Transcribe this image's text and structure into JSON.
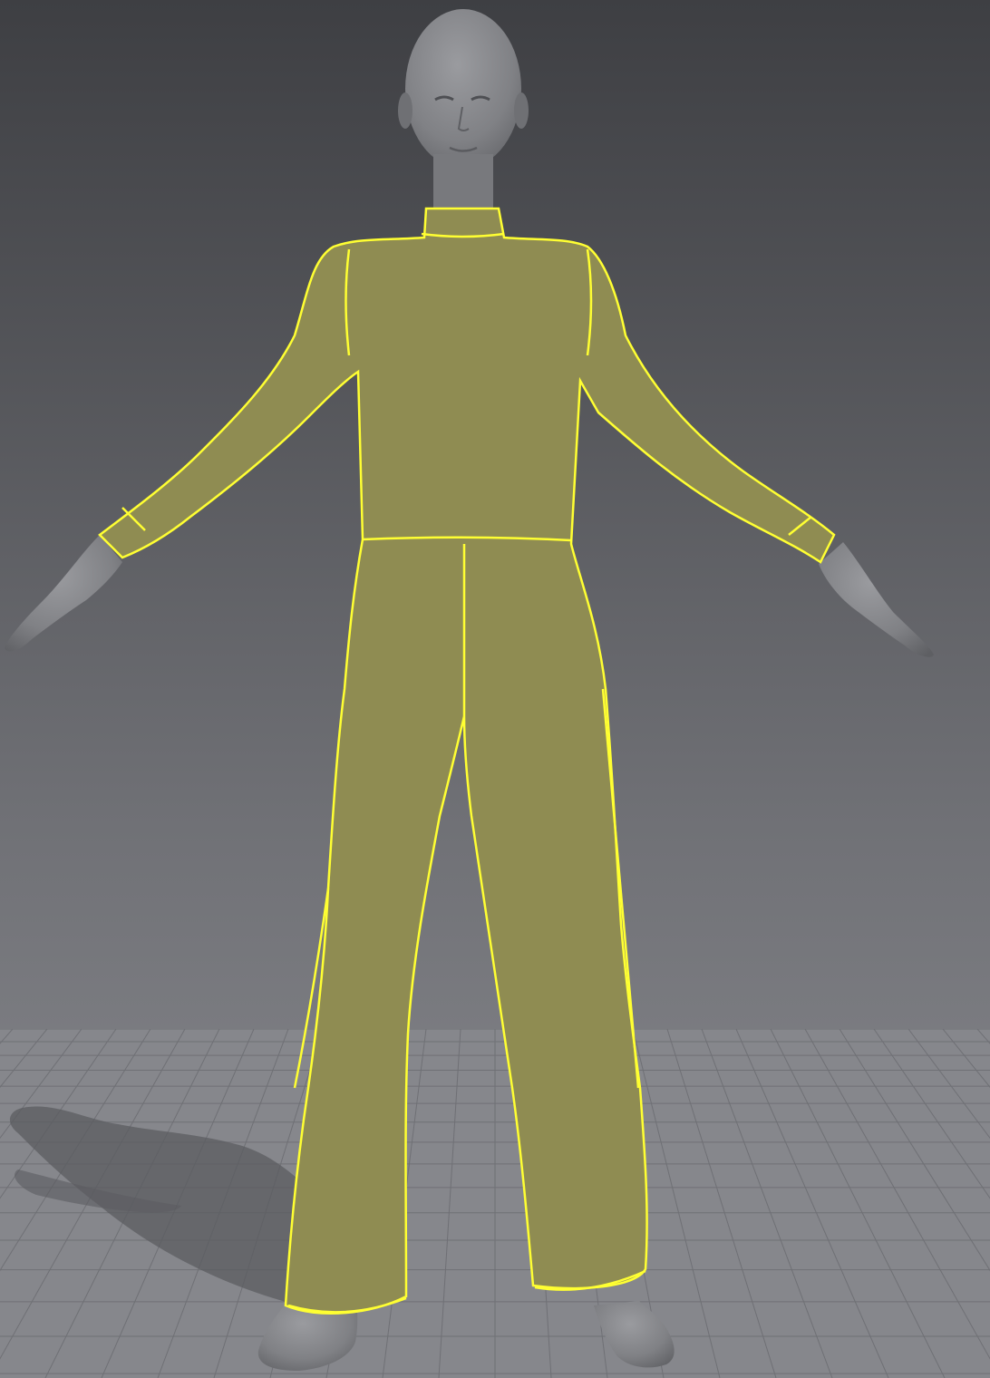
{
  "viewport": {
    "background_top": "#3e3f43",
    "background_bottom": "#8b8c91",
    "floor_color": "#86878c",
    "floor_grid_color": "#6f7075",
    "avatar_skin": "#818286",
    "avatar_shade": "#5e5f63",
    "garment_fill": "#8f8c52",
    "garment_mesh": "#fffcc8",
    "seam_color": "#ffff32",
    "shadow_color": "#5b5c60"
  },
  "avatar": {
    "pose": "A-pose",
    "icon": "mannequin-icon"
  },
  "garment": {
    "type": "long-sleeve mock-neck jumpsuit with flared legs",
    "display_mode": "mesh",
    "selected": true,
    "pieces": [
      "collar",
      "bodice",
      "left-sleeve",
      "right-sleeve",
      "left-cuff",
      "right-cuff",
      "left-leg",
      "right-leg"
    ]
  }
}
